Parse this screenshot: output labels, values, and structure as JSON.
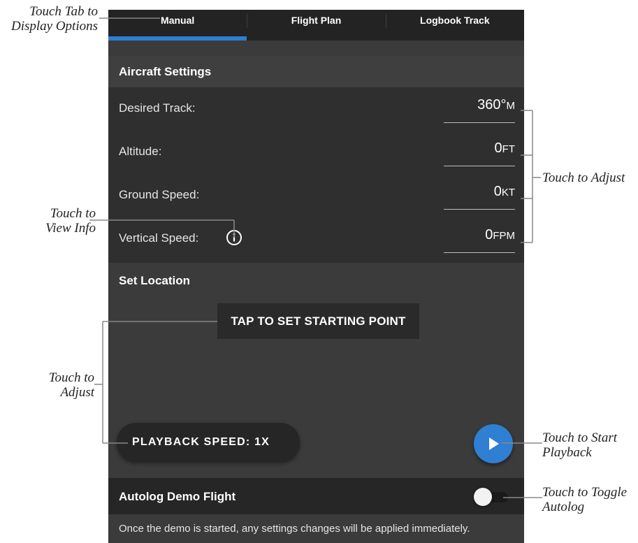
{
  "tabs": [
    {
      "label": "Manual",
      "active": true
    },
    {
      "label": "Flight Plan",
      "active": false
    },
    {
      "label": "Logbook Track",
      "active": false
    }
  ],
  "accent_color": "#2d7fd0",
  "aircraft_settings": {
    "title": "Aircraft Settings",
    "rows": [
      {
        "label": "Desired Track:",
        "value": "360°",
        "unit": "M"
      },
      {
        "label": "Altitude:",
        "value": "0",
        "unit": "FT"
      },
      {
        "label": "Ground Speed:",
        "value": "0",
        "unit": "KT"
      },
      {
        "label": "Vertical Speed:",
        "value": "0",
        "unit": "FPM",
        "icon": "info-icon"
      }
    ]
  },
  "set_location": {
    "title": "Set Location",
    "start_point_button": "TAP TO SET STARTING POINT",
    "playback_speed_button": "PLAYBACK SPEED: 1X",
    "play_button_icon": "play-icon"
  },
  "autolog": {
    "label": "Autolog Demo Flight",
    "enabled": false
  },
  "footer_note": "Once the demo is started, any settings changes will be applied immediately.",
  "callouts": {
    "tabs": [
      "Touch Tab to",
      "Display Options"
    ],
    "info": [
      "Touch to",
      "View Info"
    ],
    "adjust_settings": "Touch to Adjust",
    "adjust_location": [
      "Touch to",
      "Adjust"
    ],
    "start_playback": [
      "Touch to Start",
      "Playback"
    ],
    "toggle_autolog": [
      "Touch to Toggle",
      "Autolog"
    ]
  }
}
